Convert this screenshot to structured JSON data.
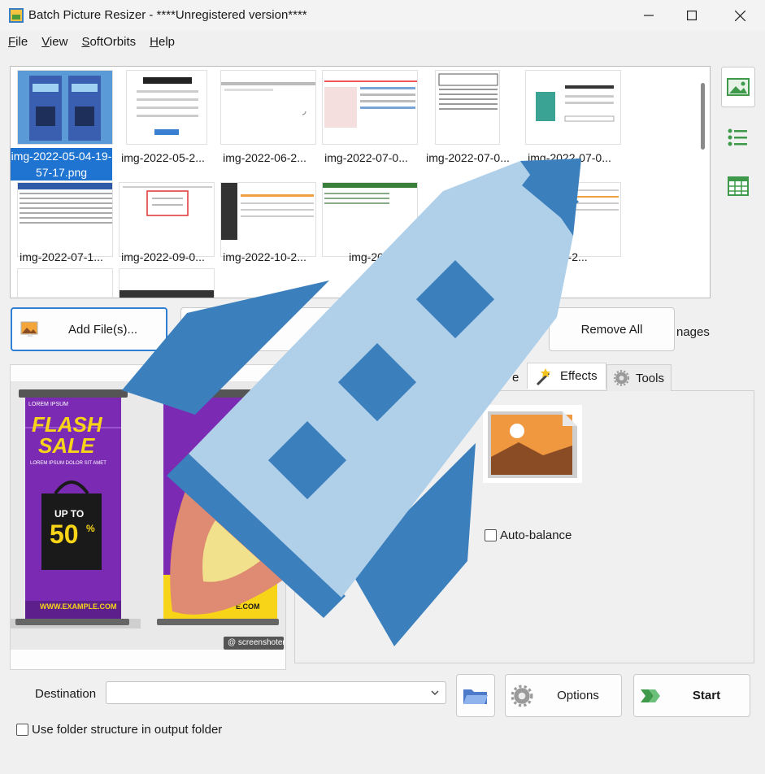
{
  "window": {
    "title": "Batch Picture Resizer - ****Unregistered version****",
    "minimize_label": "—",
    "maximize_label": "□",
    "close_label": "✕"
  },
  "menu": {
    "items": [
      "File",
      "View",
      "SoftOrbits",
      "Help"
    ]
  },
  "thumbnails": [
    {
      "label": "img-2022-05-04-19-57-17.png",
      "selected": true
    },
    {
      "label": "img-2022-05-2...",
      "selected": false
    },
    {
      "label": "img-2022-06-2...",
      "selected": false
    },
    {
      "label": "img-2022-07-0...",
      "selected": false
    },
    {
      "label": "img-2022-07-0...",
      "selected": false
    },
    {
      "label": "img-2022-07-0...",
      "selected": false
    },
    {
      "label": "img-2022-07-1...",
      "selected": false
    },
    {
      "label": "img-2022-09-0...",
      "selected": false
    },
    {
      "label": "img-2022-10-2...",
      "selected": false
    },
    {
      "label": "img-20",
      "selected": false
    },
    {
      "label": "",
      "selected": false
    },
    {
      "label": "-10-2...",
      "selected": false
    }
  ],
  "toolbar": {
    "add_files_label": "Add File(s)...",
    "remove_all_label": "Remove All",
    "images_suffix": "nages"
  },
  "tabs": {
    "partial_label": "e",
    "effects_label": "Effects",
    "tools_label": "Tools"
  },
  "effects": {
    "auto_balance_label": "Auto-balance"
  },
  "preview": {
    "brand": "LOREM IPSUM",
    "headline_1": "FLASH",
    "headline_2": "SALE",
    "subline": "LOREM IPSUM DOLOR SIT AMET",
    "offer_top": "UP TO",
    "offer_value": "50",
    "offer_suffix": "%",
    "website": "WWW.EXAMPLE.COM",
    "website_partial": "E.COM",
    "watermark": "@ screenshoter"
  },
  "bottom": {
    "destination_label": "Destination",
    "destination_value": "",
    "options_label": "Options",
    "start_label": "Start",
    "use_folder_structure_label": "Use folder structure in output folder"
  },
  "colors": {
    "accent": "#2f7fd2",
    "rocket_light": "#b0d0ea",
    "rocket_dark": "#3b7fbd",
    "flame_outer": "#df8a72",
    "flame_inner": "#f1e08c",
    "banner_purple": "#7b2bb3",
    "banner_yellow": "#f7d417"
  }
}
